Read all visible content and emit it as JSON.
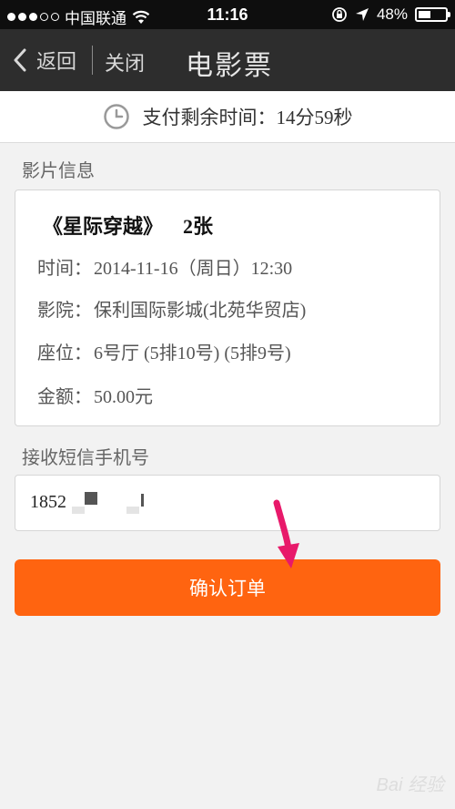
{
  "status_bar": {
    "carrier": "中国联通",
    "time": "11:16",
    "battery": "48%",
    "battery_level": 0.48,
    "icons": [
      "signal-dots-icon",
      "wifi-icon",
      "rotation-lock-icon",
      "location-icon",
      "battery-icon"
    ]
  },
  "nav": {
    "back_label": "返回",
    "close_label": "关闭",
    "title": "电影票"
  },
  "timer": {
    "text": "支付剩余时间：14分59秒",
    "icon": "clock-icon"
  },
  "movie_section": {
    "label": "影片信息",
    "title": "《星际穿越》",
    "count": "2张",
    "time_label": "时间：",
    "time_value": "2014-11-16（周日）12:30",
    "cinema_label": "影院：",
    "cinema_value": "保利国际影城(北苑华贸店)",
    "seat_label": "座位：",
    "seat_value": "6号厅 (5排10号) (5排9号)",
    "amount_label": "金额：",
    "amount_value": "50.00元"
  },
  "phone_section": {
    "label": "接收短信手机号",
    "value": "1852"
  },
  "confirm_button": {
    "label": "确认订单"
  },
  "watermark": {
    "text": "Bai 经验"
  },
  "colors": {
    "accent": "#ff6410",
    "nav_bg": "#2d2d2d",
    "status_bg": "#0e0e0e",
    "arrow": "#e8196a"
  }
}
